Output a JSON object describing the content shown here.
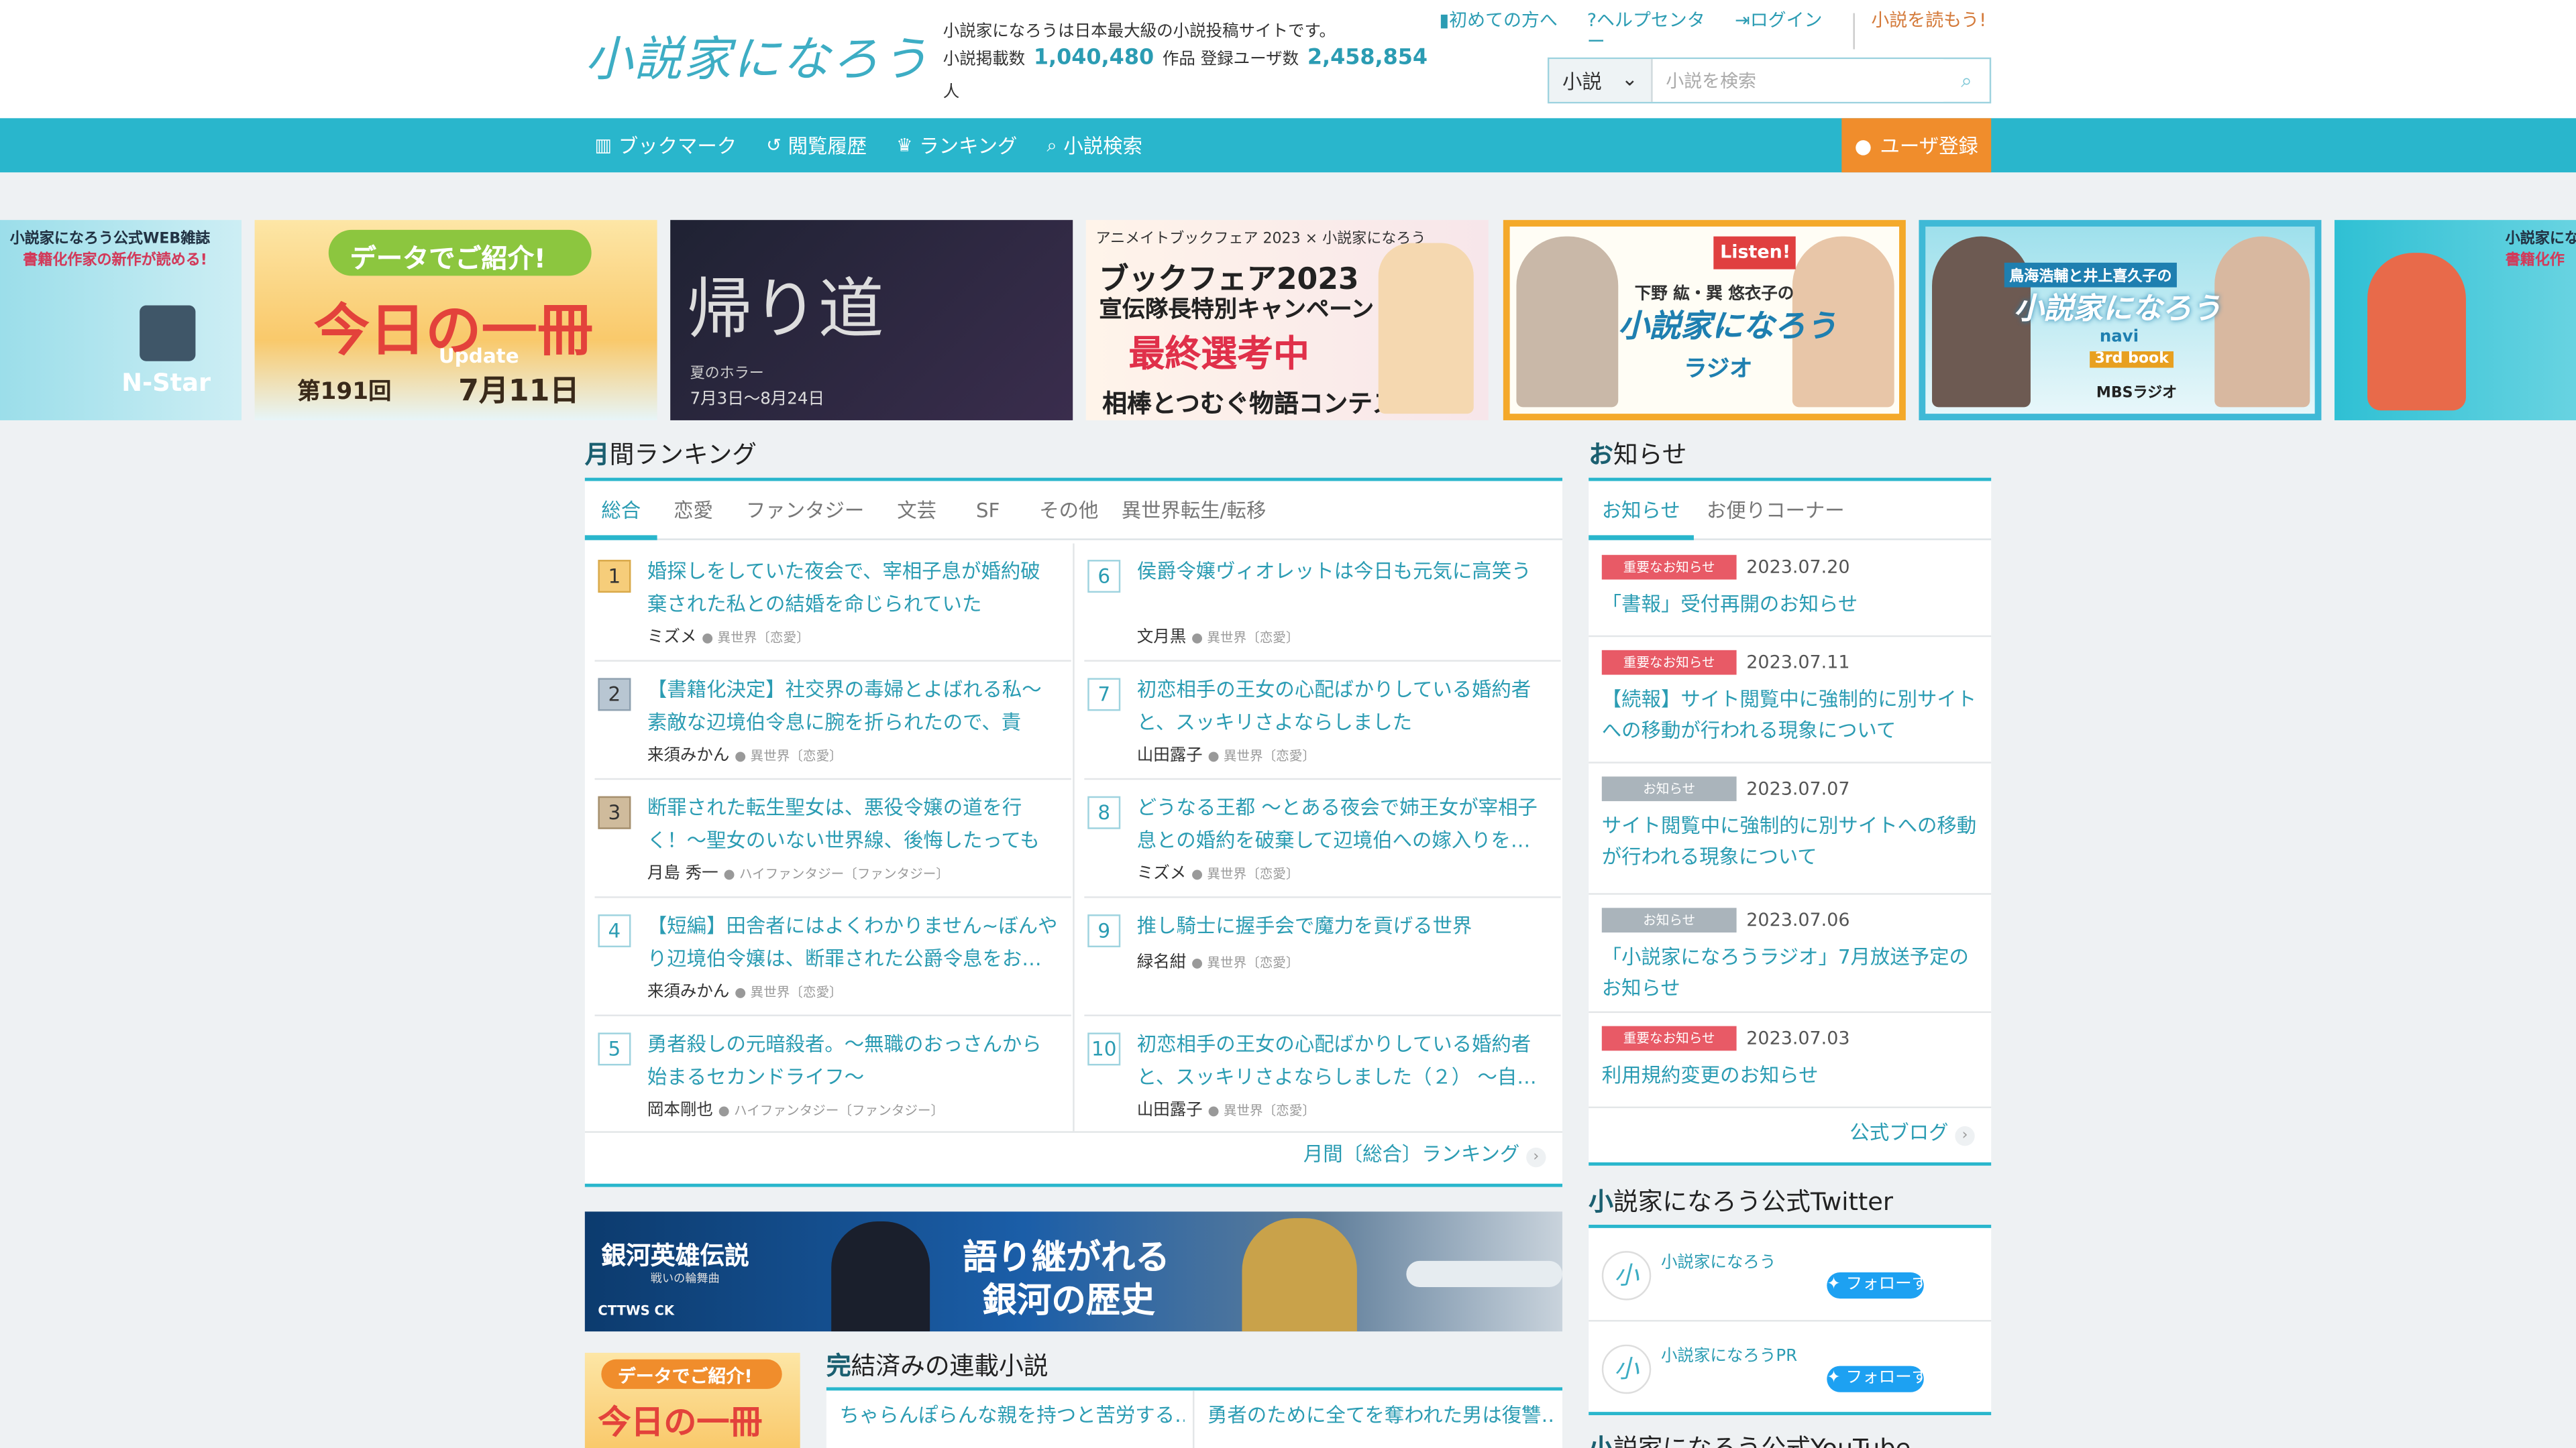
{
  "header": {
    "logo": "小説家になろう",
    "description": "小説家になろうは日本最大級の小説投稿サイトです。",
    "novel_count_label": "小説掲載数",
    "novel_count": "1,040,480",
    "novel_unit": "作品",
    "user_count_label": "登録ユーザ数",
    "user_count": "2,458,854",
    "user_unit": "人",
    "links": [
      "初めての方へ",
      "ヘルプセンター",
      "ログイン"
    ],
    "yomu": "小説を読もう!",
    "search_select": "小説",
    "search_placeholder": "小説を検索"
  },
  "nav": {
    "items": [
      "ブックマーク",
      "閲覧履歴",
      "ランキング",
      "小説検索"
    ],
    "register": "ユーザ登録"
  },
  "banners": {
    "b1_line1": "小説家になろう公式WEB雑誌",
    "b1_line2": "書籍化作家の新作が読める!",
    "b1_brand": "N-Star",
    "b2_top": "データでご紹介!",
    "b2_main": "今日の一冊",
    "b2_update": "Update",
    "b2_issue": "第191回",
    "b2_date": "7月11日",
    "b3_title": "帰り道",
    "b3_sub": "夏のホラー",
    "b3_date": "7月3日～8月24日",
    "b4_top": "アニメイトブックフェア 2023 × 小説家になろう",
    "b4_l1": "ブックフェア2023",
    "b4_l2": "宣伝隊長特別キャンペーン",
    "b4_l3": "最終選考中",
    "b4_l4": "相棒とつむぐ物語コンテスト",
    "b5_listen": "Listen!",
    "b5_l1": "下野 紘・巽 悠衣子の",
    "b5_l2": "小説家になろう",
    "b5_l3": "ラジオ",
    "b6_l1": "鳥海浩輔と井上喜久子の",
    "b6_l2": "小説家になろう",
    "b6_l3": "navi",
    "b6_l4": "3rd book",
    "b6_l5": "MBSラジオ",
    "b7_line1": "小説家になろう公式",
    "b7_line2": "書籍化作"
  },
  "ranking": {
    "title_head": "月",
    "title_rest": "間ランキング",
    "tabs": [
      "総合",
      "恋愛",
      "ファンタジー",
      "文芸",
      "SF",
      "その他",
      "異世界転生/転移"
    ],
    "items": [
      {
        "rank": "1",
        "title": "婚探しをしていた夜会で、宰相子息が婚約破棄された私との結婚を命じられていた",
        "author": "ミズメ",
        "genre": "異世界〔恋愛〕"
      },
      {
        "rank": "2",
        "title": "【書籍化決定】社交界の毒婦とよばれる私～素敵な辺境伯令息に腕を折られたので、責任…",
        "author": "来須みかん",
        "genre": "異世界〔恋愛〕"
      },
      {
        "rank": "3",
        "title": "断罪された転生聖女は、悪役令嬢の道を行く！～聖女のいない世界線、後悔したってもう…",
        "author": "月島 秀一",
        "genre": "ハイファンタジー〔ファンタジー〕"
      },
      {
        "rank": "4",
        "title": "【短編】田舎者にはよくわかりません~ぼんやり辺境伯令嬢は、断罪された公爵令息をお…",
        "author": "来須みかん",
        "genre": "異世界〔恋愛〕"
      },
      {
        "rank": "5",
        "title": "勇者殺しの元暗殺者。～無職のおっさんから始まるセカンドライフ～",
        "author": "岡本剛也",
        "genre": "ハイファンタジー〔ファンタジー〕"
      },
      {
        "rank": "6",
        "title": "侯爵令嬢ヴィオレットは今日も元気に高笑う",
        "author": "文月黒",
        "genre": "異世界〔恋愛〕"
      },
      {
        "rank": "7",
        "title": "初恋相手の王女の心配ばかりしている婚約者と、スッキリさよならしました",
        "author": "山田露子",
        "genre": "異世界〔恋愛〕"
      },
      {
        "rank": "8",
        "title": "どうなる王都 ～とある夜会で姉王女が宰相子息との婚約を破棄して辺境伯への嫁入りを…",
        "author": "ミズメ",
        "genre": "異世界〔恋愛〕"
      },
      {
        "rank": "9",
        "title": "推し騎士に握手会で魔力を貢げる世界",
        "author": "緑名紺",
        "genre": "異世界〔恋愛〕"
      },
      {
        "rank": "10",
        "title": "初恋相手の王女の心配ばかりしている婚約者と、スッキリさよならしました（２） ～自…",
        "author": "山田露子",
        "genre": "異世界〔恋愛〕"
      }
    ],
    "more": "月間〔総合〕ランキング"
  },
  "ginga": {
    "title": "銀河英雄伝説",
    "sub": "戦いの輪舞曲",
    "l1": "語り継がれる",
    "l2": "銀河の歴史",
    "logo": "CTTWS CK"
  },
  "small_banner": {
    "top": "データでご紹介!",
    "main": "今日の一冊"
  },
  "kanketsu": {
    "title_head": "完",
    "title_rest": "結済みの連載小説",
    "items": [
      "ちゃらんぽらんな親を持つと苦労する…",
      "勇者のために全てを奪われた男は復讐…"
    ]
  },
  "news": {
    "title_head": "お",
    "title_rest": "知らせ",
    "tabs": [
      "お知らせ",
      "お便りコーナー"
    ],
    "items": [
      {
        "badge": "重要なお知らせ",
        "date": "2023.07.20",
        "text": "「書報」受付再開のお知らせ"
      },
      {
        "badge": "重要なお知らせ",
        "date": "2023.07.11",
        "text": "【続報】サイト閲覧中に強制的に別サイトへの移動が行われる現象について"
      },
      {
        "badge": "お知らせ",
        "date": "2023.07.07",
        "text": "サイト閲覧中に強制的に別サイトへの移動が行われる現象について"
      },
      {
        "badge": "お知らせ",
        "date": "2023.07.06",
        "text": "「小説家になろうラジオ」7月放送予定のお知らせ"
      },
      {
        "badge": "重要なお知らせ",
        "date": "2023.07.03",
        "text": "利用規約変更のお知らせ"
      }
    ],
    "more": "公式ブログ"
  },
  "twitter": {
    "title_head": "小",
    "title_rest": "説家になろう公式Twitter",
    "accounts": [
      {
        "name": "小説家になろう",
        "button": "フォローする"
      },
      {
        "name": "小説家になろうPR",
        "button": "フォローする"
      }
    ]
  },
  "youtube": {
    "title_head": "小",
    "title_rest": "説家になろう公式YouTube"
  },
  "colors": {
    "accent": "#29b6cc",
    "link": "#2b9cb3",
    "register": "#f08d2c",
    "important": "#e85a66"
  }
}
